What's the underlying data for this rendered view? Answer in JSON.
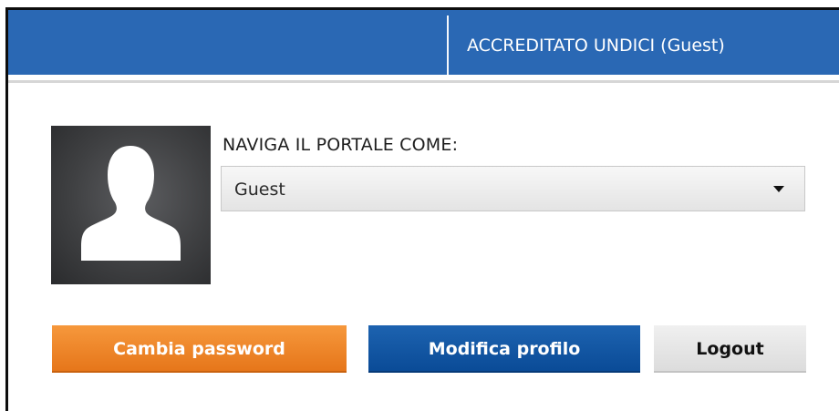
{
  "header": {
    "user_label": "ACCREDITATO UNDICI (Guest)"
  },
  "profile": {
    "avatar_icon": "user-silhouette-icon",
    "nav_label": "NAVIGA IL PORTALE COME:",
    "role_select": {
      "selected": "Guest"
    }
  },
  "actions": {
    "change_password": "Cambia password",
    "edit_profile": "Modifica profilo",
    "logout": "Logout"
  },
  "colors": {
    "header_bg": "#2a68b4",
    "change_password_bg": "#f08a2c",
    "edit_profile_bg": "#0f55a3",
    "logout_bg": "#e6e6e6"
  }
}
